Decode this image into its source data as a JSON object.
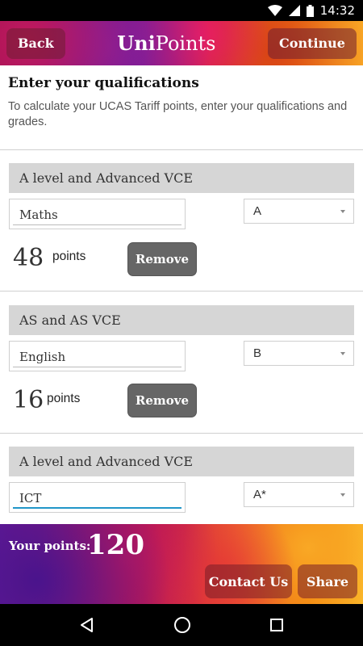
{
  "status_bar": {
    "time": "14:32",
    "icons": [
      "wifi-icon",
      "signal-icon",
      "battery-icon"
    ]
  },
  "header": {
    "back_label": "Back",
    "title_bold": "Uni",
    "title_light": "Points",
    "continue_label": "Continue"
  },
  "intro": {
    "heading": "Enter your qualifications",
    "description": "To calculate your UCAS Tariff points, enter your qualifications and grades."
  },
  "qualifications": [
    {
      "type": "A level and Advanced VCE",
      "subject": "Maths",
      "grade": "A",
      "points": "48",
      "points_label": "points",
      "remove_label": "Remove"
    },
    {
      "type": "AS and AS VCE",
      "subject": "English",
      "grade": "B",
      "points": "16",
      "points_label": "points",
      "remove_label": "Remove"
    },
    {
      "type": "A level and Advanced VCE",
      "subject": "ICT",
      "grade": "A*"
    }
  ],
  "footer": {
    "your_points_label": "Your points:",
    "total_points": "120",
    "contact_label": "Contact Us",
    "share_label": "Share"
  },
  "nav": {
    "icons": [
      "back-triangle-icon",
      "home-circle-icon",
      "recents-square-icon"
    ]
  }
}
